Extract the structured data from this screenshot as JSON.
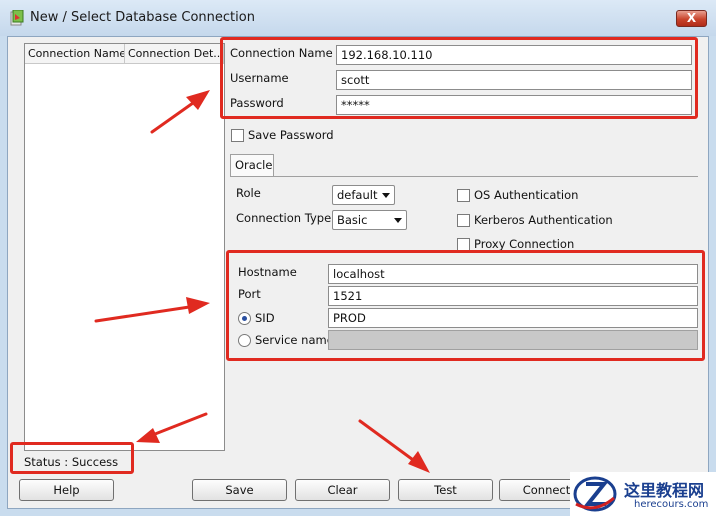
{
  "window": {
    "title": "New / Select Database Connection",
    "close_label": "X"
  },
  "list": {
    "columns": [
      "Connection Name",
      "Connection Det..."
    ]
  },
  "form": {
    "connection_name_label": "Connection Name",
    "connection_name_value": "192.168.10.110",
    "username_label": "Username",
    "username_value": "scott",
    "password_label": "Password",
    "password_value": "*****",
    "save_password_label": "Save Password"
  },
  "tab": {
    "label": "Oracle"
  },
  "oracle": {
    "role_label": "Role",
    "role_value": "default",
    "conn_type_label": "Connection Type",
    "conn_type_value": "Basic",
    "os_auth_label": "OS Authentication",
    "kerberos_label": "Kerberos Authentication",
    "proxy_label": "Proxy Connection",
    "hostname_label": "Hostname",
    "hostname_value": "localhost",
    "port_label": "Port",
    "port_value": "1521",
    "sid_label": "SID",
    "sid_value": "PROD",
    "service_label": "Service name",
    "service_value": ""
  },
  "status": {
    "text": "Status : Success"
  },
  "buttons": {
    "help": "Help",
    "save": "Save",
    "clear": "Clear",
    "test": "Test",
    "connect": "Connect"
  },
  "watermark": {
    "cn": "这里教程网",
    "en": "herecours.com"
  },
  "colors": {
    "annotation": "#e02a20",
    "disabled_field": "#c8c8c8"
  }
}
